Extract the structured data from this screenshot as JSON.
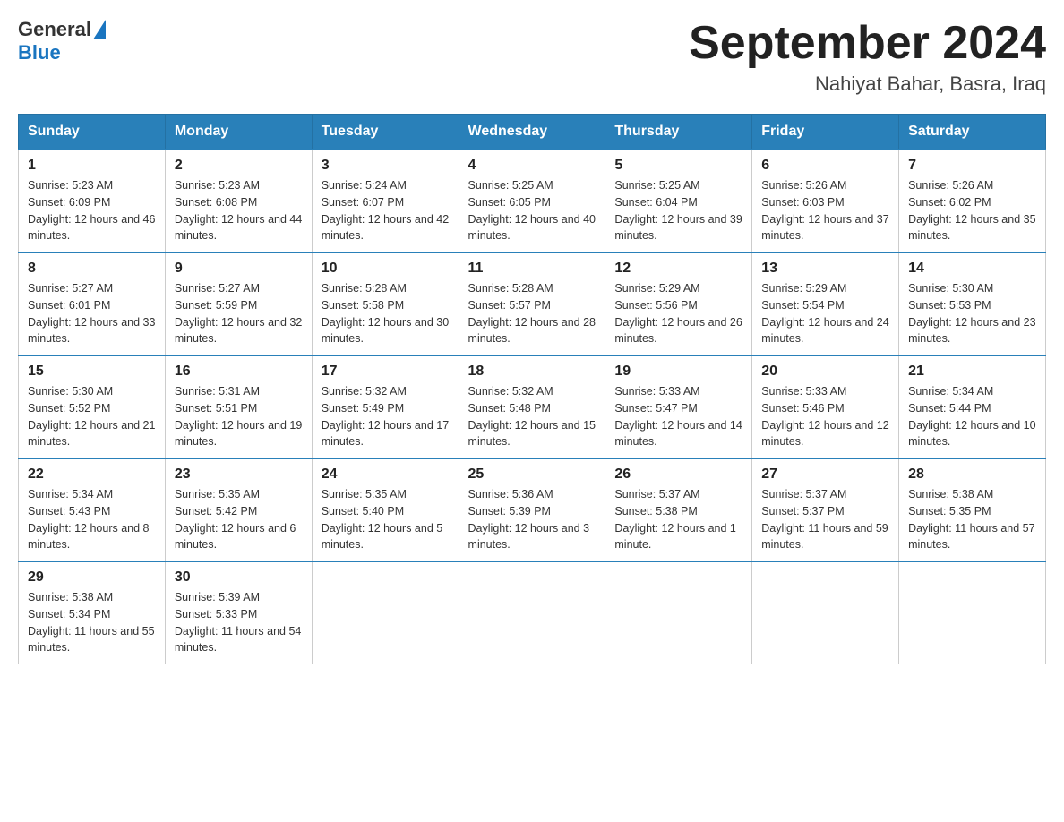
{
  "header": {
    "logo": {
      "general": "General",
      "blue": "Blue"
    },
    "title": "September 2024",
    "subtitle": "Nahiyat Bahar, Basra, Iraq"
  },
  "calendar": {
    "days_of_week": [
      "Sunday",
      "Monday",
      "Tuesday",
      "Wednesday",
      "Thursday",
      "Friday",
      "Saturday"
    ],
    "weeks": [
      [
        {
          "day": "1",
          "sunrise": "5:23 AM",
          "sunset": "6:09 PM",
          "daylight": "12 hours and 46 minutes."
        },
        {
          "day": "2",
          "sunrise": "5:23 AM",
          "sunset": "6:08 PM",
          "daylight": "12 hours and 44 minutes."
        },
        {
          "day": "3",
          "sunrise": "5:24 AM",
          "sunset": "6:07 PM",
          "daylight": "12 hours and 42 minutes."
        },
        {
          "day": "4",
          "sunrise": "5:25 AM",
          "sunset": "6:05 PM",
          "daylight": "12 hours and 40 minutes."
        },
        {
          "day": "5",
          "sunrise": "5:25 AM",
          "sunset": "6:04 PM",
          "daylight": "12 hours and 39 minutes."
        },
        {
          "day": "6",
          "sunrise": "5:26 AM",
          "sunset": "6:03 PM",
          "daylight": "12 hours and 37 minutes."
        },
        {
          "day": "7",
          "sunrise": "5:26 AM",
          "sunset": "6:02 PM",
          "daylight": "12 hours and 35 minutes."
        }
      ],
      [
        {
          "day": "8",
          "sunrise": "5:27 AM",
          "sunset": "6:01 PM",
          "daylight": "12 hours and 33 minutes."
        },
        {
          "day": "9",
          "sunrise": "5:27 AM",
          "sunset": "5:59 PM",
          "daylight": "12 hours and 32 minutes."
        },
        {
          "day": "10",
          "sunrise": "5:28 AM",
          "sunset": "5:58 PM",
          "daylight": "12 hours and 30 minutes."
        },
        {
          "day": "11",
          "sunrise": "5:28 AM",
          "sunset": "5:57 PM",
          "daylight": "12 hours and 28 minutes."
        },
        {
          "day": "12",
          "sunrise": "5:29 AM",
          "sunset": "5:56 PM",
          "daylight": "12 hours and 26 minutes."
        },
        {
          "day": "13",
          "sunrise": "5:29 AM",
          "sunset": "5:54 PM",
          "daylight": "12 hours and 24 minutes."
        },
        {
          "day": "14",
          "sunrise": "5:30 AM",
          "sunset": "5:53 PM",
          "daylight": "12 hours and 23 minutes."
        }
      ],
      [
        {
          "day": "15",
          "sunrise": "5:30 AM",
          "sunset": "5:52 PM",
          "daylight": "12 hours and 21 minutes."
        },
        {
          "day": "16",
          "sunrise": "5:31 AM",
          "sunset": "5:51 PM",
          "daylight": "12 hours and 19 minutes."
        },
        {
          "day": "17",
          "sunrise": "5:32 AM",
          "sunset": "5:49 PM",
          "daylight": "12 hours and 17 minutes."
        },
        {
          "day": "18",
          "sunrise": "5:32 AM",
          "sunset": "5:48 PM",
          "daylight": "12 hours and 15 minutes."
        },
        {
          "day": "19",
          "sunrise": "5:33 AM",
          "sunset": "5:47 PM",
          "daylight": "12 hours and 14 minutes."
        },
        {
          "day": "20",
          "sunrise": "5:33 AM",
          "sunset": "5:46 PM",
          "daylight": "12 hours and 12 minutes."
        },
        {
          "day": "21",
          "sunrise": "5:34 AM",
          "sunset": "5:44 PM",
          "daylight": "12 hours and 10 minutes."
        }
      ],
      [
        {
          "day": "22",
          "sunrise": "5:34 AM",
          "sunset": "5:43 PM",
          "daylight": "12 hours and 8 minutes."
        },
        {
          "day": "23",
          "sunrise": "5:35 AM",
          "sunset": "5:42 PM",
          "daylight": "12 hours and 6 minutes."
        },
        {
          "day": "24",
          "sunrise": "5:35 AM",
          "sunset": "5:40 PM",
          "daylight": "12 hours and 5 minutes."
        },
        {
          "day": "25",
          "sunrise": "5:36 AM",
          "sunset": "5:39 PM",
          "daylight": "12 hours and 3 minutes."
        },
        {
          "day": "26",
          "sunrise": "5:37 AM",
          "sunset": "5:38 PM",
          "daylight": "12 hours and 1 minute."
        },
        {
          "day": "27",
          "sunrise": "5:37 AM",
          "sunset": "5:37 PM",
          "daylight": "11 hours and 59 minutes."
        },
        {
          "day": "28",
          "sunrise": "5:38 AM",
          "sunset": "5:35 PM",
          "daylight": "11 hours and 57 minutes."
        }
      ],
      [
        {
          "day": "29",
          "sunrise": "5:38 AM",
          "sunset": "5:34 PM",
          "daylight": "11 hours and 55 minutes."
        },
        {
          "day": "30",
          "sunrise": "5:39 AM",
          "sunset": "5:33 PM",
          "daylight": "11 hours and 54 minutes."
        },
        null,
        null,
        null,
        null,
        null
      ]
    ]
  }
}
